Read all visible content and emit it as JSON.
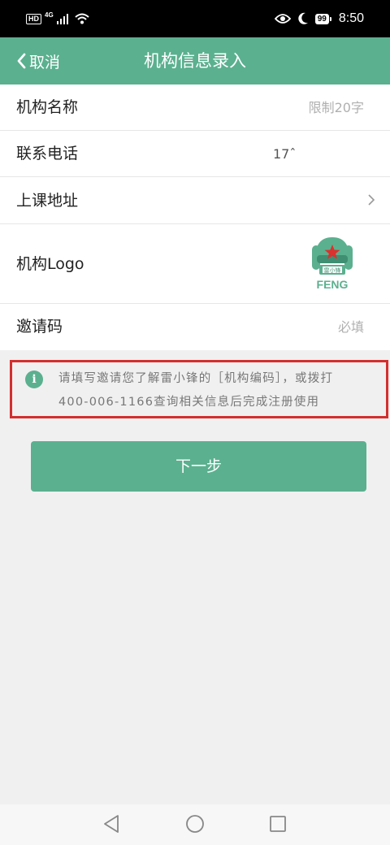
{
  "status_bar": {
    "hd": "HD",
    "network": "4G",
    "battery": "99",
    "time": "8:50",
    "icons": [
      "signal-icon",
      "wifi-icon",
      "eye-icon",
      "moon-icon",
      "battery-icon"
    ]
  },
  "header": {
    "back_label": "取消",
    "title": "机构信息录入"
  },
  "form": {
    "name": {
      "label": "机构名称",
      "placeholder": "限制20字"
    },
    "phone": {
      "label": "联系电话",
      "value": "17ˆ"
    },
    "address": {
      "label": "上课地址"
    },
    "logo": {
      "label": "机构Logo",
      "logo_text": "FENG"
    },
    "invite": {
      "label": "邀请码",
      "placeholder": "必填"
    }
  },
  "tip": {
    "icon": "info-icon",
    "line1": "请填写邀请您了解雷小锋的［机构编码］，或拨打",
    "line2": "400-006-1166查询相关信息后完成注册使用"
  },
  "next_button": {
    "label": "下一步"
  },
  "colors": {
    "accent": "#5bb08f",
    "highlight_border": "#d32f2f",
    "logo_star": "#d9322f",
    "background": "#f0f0f0"
  }
}
